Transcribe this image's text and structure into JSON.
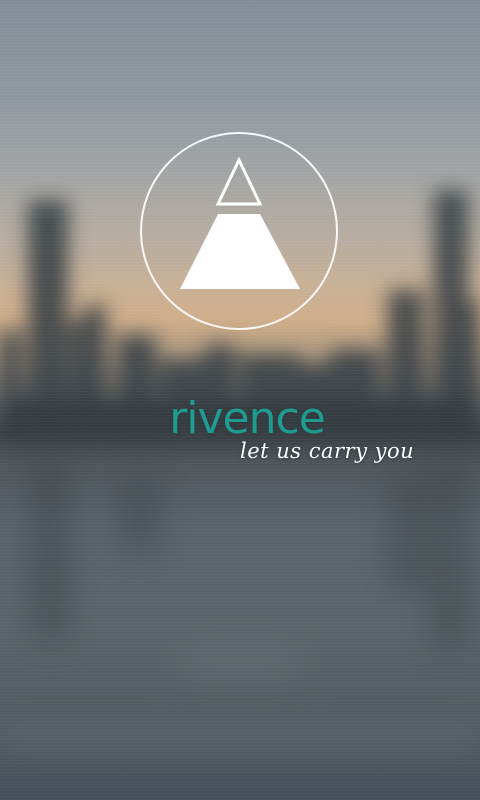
{
  "app": {
    "brand_name": "rivence",
    "tagline": "let us carry you",
    "logo_icon": "pyramid-logo-icon"
  },
  "colors": {
    "brand": "#1f9b8f",
    "logo_stroke": "#ffffff",
    "tagline": "#ffffff",
    "sky_top": "#848d97",
    "sunset": "#cfae8a",
    "water": "#5a646a"
  },
  "background": {
    "image": "blurred-city-skyline-sunset-background"
  }
}
